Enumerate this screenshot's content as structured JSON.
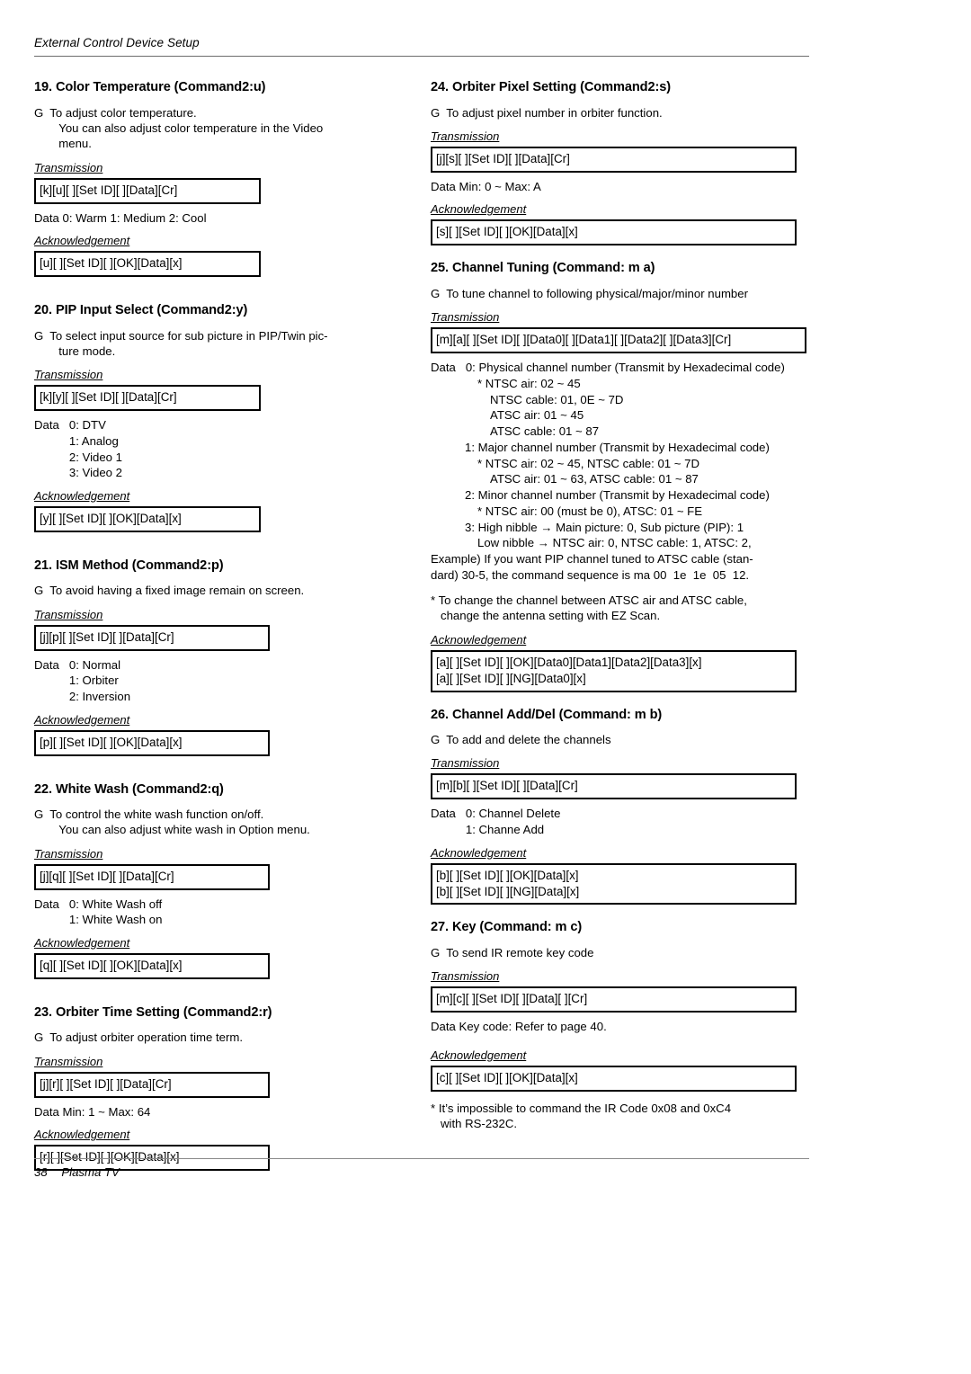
{
  "header": {
    "running_title": "External Control Device Setup"
  },
  "footer": {
    "page_number": "38",
    "doc_title": "Plasma TV"
  },
  "labels": {
    "transmission": "Transmission",
    "acknowledgement": "Acknowledgement",
    "bullet": "G",
    "data": "Data"
  },
  "left_column": {
    "s19": {
      "title": "19. Color Temperature (Command2:u)",
      "desc_line1": "To adjust color temperature.",
      "desc_line2": "You can also adjust color temperature in the Video",
      "desc_line3": "menu.",
      "transmission": "[k][u][  ][Set ID][  ][Data][Cr]",
      "data_line": "Data   0: Warm    1: Medium   2: Cool",
      "ack": "[u][  ][Set ID][  ][OK][Data][x]"
    },
    "s20": {
      "title": "20. PIP Input Select (Command2:y)",
      "desc_line1": "To select input source for sub picture in PIP/Twin pic-",
      "desc_line2": "ture mode.",
      "transmission": "[k][y][  ][Set ID][  ][Data][Cr]",
      "data_key": "Data",
      "data_values": [
        "0: DTV",
        "1: Analog",
        "2: Video 1",
        "3: Video 2"
      ],
      "ack": "[y][  ][Set ID][  ][OK][Data][x]"
    },
    "s21": {
      "title": "21. ISM Method (Command2:p)",
      "desc_line1": "To avoid having a fixed image remain on screen.",
      "transmission": "[j][p][  ][Set ID][  ][Data][Cr]",
      "data_key": "Data",
      "data_values": [
        "0: Normal",
        "1: Orbiter",
        "2: Inversion"
      ],
      "ack": "[p][  ][Set ID][  ][OK][Data][x]"
    },
    "s22": {
      "title": "22. White Wash (Command2:q)",
      "desc_line1": "To control the white wash function on/off.",
      "desc_line2": "You can also adjust white wash in Option menu.",
      "transmission": "[j][q][  ][Set ID][  ][Data][Cr]",
      "data_key": "Data",
      "data_values": [
        "0: White Wash off",
        "1: White Wash on"
      ],
      "ack": "[q][  ][Set ID][  ][OK][Data][x]"
    },
    "s23": {
      "title": "23. Orbiter Time Setting (Command2:r)",
      "desc_line1": "To adjust orbiter operation time term.",
      "transmission": "[j][r][  ][Set ID][  ][Data][Cr]",
      "data_line": "Data   Min: 1 ~ Max: 64",
      "ack": "[r][  ][Set ID][  ][OK][Data][x]"
    }
  },
  "right_column": {
    "s24": {
      "title": "24. Orbiter Pixel Setting (Command2:s)",
      "desc_line1": "To adjust pixel number in orbiter function.",
      "transmission": "[j][s][  ][Set ID][  ][Data][Cr]",
      "data_line": "Data   Min: 0 ~ Max: A",
      "ack": "[s][  ][Set ID][  ][OK][Data][x]"
    },
    "s25": {
      "title": "25. Channel Tuning (Command: m a)",
      "desc_line1": "To tune channel to following physical/major/minor number",
      "transmission": "[m][a][  ][Set ID][  ][Data0][  ][Data1][  ][Data2][  ][Data3][Cr]",
      "data_lines": [
        "Data   0: Physical channel number (Transmit by Hexadecimal code)",
        "* NTSC air: 02 ~ 45",
        "NTSC cable: 01, 0E ~ 7D",
        "ATSC air: 01 ~ 45",
        "ATSC cable: 01 ~ 87",
        "1: Major channel number (Transmit by Hexadecimal code)",
        "* NTSC air: 02 ~ 45, NTSC cable: 01 ~ 7D",
        "ATSC air: 01 ~ 63, ATSC cable: 01 ~ 87",
        "2: Minor channel number (Transmit by Hexadecimal code)",
        "* NTSC air: 00 (must be 0), ATSC: 01 ~ FE",
        "3: High nibble → Main picture: 0, Sub picture (PIP): 1",
        "Low nibble → NTSC air: 0, NTSC cable: 1, ATSC: 2,"
      ],
      "example_line1": "Example) If you want PIP channel tuned to ATSC cable (stan-",
      "example_line2": "dard) 30-5, the command sequence is ma 00  1e  1e  05  12.",
      "note_star": "*",
      "note_line1": "To change the channel between ATSC air and ATSC cable,",
      "note_line2": "change the antenna setting with EZ Scan.",
      "ack_line1": "[a][  ][Set ID][  ][OK][Data0][Data1][Data2][Data3][x]",
      "ack_line2": "[a][  ][Set ID][  ][NG][Data0][x]"
    },
    "s26": {
      "title": "26. Channel Add/Del (Command: m b)",
      "desc_line1": "To add and delete the channels",
      "transmission": "[m][b][  ][Set ID][  ][Data][Cr]",
      "data_key": "Data",
      "data_values": [
        "0: Channel Delete",
        "1: Channe Add"
      ],
      "ack_line1": "[b][  ][Set ID][  ][OK][Data][x]",
      "ack_line2": "[b][  ][Set ID][  ][NG][Data][x]"
    },
    "s27": {
      "title": "27. Key (Command: m c)",
      "desc_line1": "To send IR remote key code",
      "transmission": "[m][c][  ][Set ID][  ][Data][  ][Cr]",
      "data_line": "Data   Key code: Refer to page 40.",
      "ack": "[c][  ][Set ID][  ][OK][Data][x]",
      "note_star": "*",
      "note_line1": "It’s impossible to command the IR Code 0x08 and 0xC4",
      "note_line2": "with RS-232C."
    }
  }
}
